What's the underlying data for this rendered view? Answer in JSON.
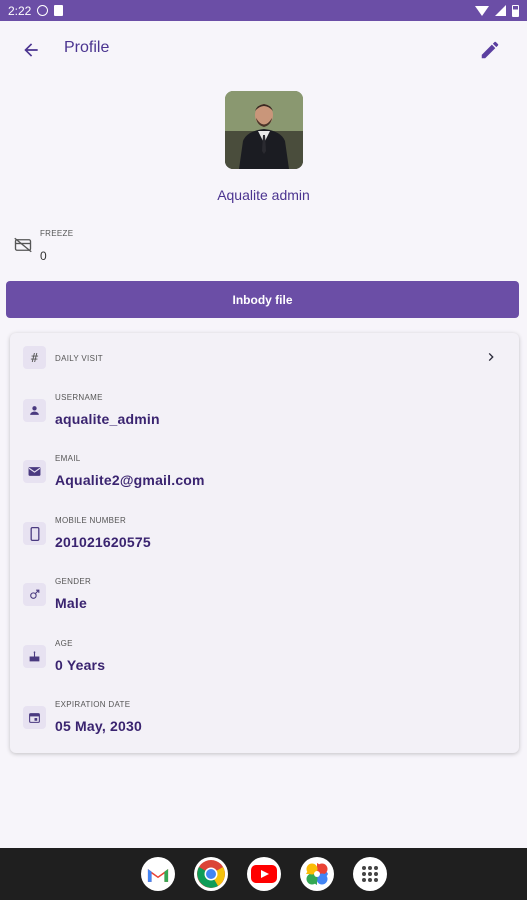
{
  "status_bar": {
    "time": "2:22"
  },
  "app_bar": {
    "title": "Profile"
  },
  "profile": {
    "name": "Aqualite admin"
  },
  "freeze": {
    "label": "FREEZE",
    "value": "0"
  },
  "inbody_button": {
    "label": "Inbody file"
  },
  "details": {
    "daily_visit": {
      "label": "DAILY VISIT"
    },
    "username": {
      "label": "USERNAME",
      "value": "aqualite_admin"
    },
    "email": {
      "label": "EMAIL",
      "value": "Aqualite2@gmail.com"
    },
    "mobile": {
      "label": "MOBILE NUMBER",
      "value": "201021620575"
    },
    "gender": {
      "label": "GENDER",
      "value": "Male"
    },
    "age": {
      "label": "AGE",
      "value": "0 Years"
    },
    "expiration": {
      "label": "EXPIRATION DATE",
      "value": "05 May, 2030"
    }
  },
  "dock": {
    "apps": [
      "gmail-icon",
      "chrome-icon",
      "youtube-icon",
      "photos-icon",
      "app-drawer-icon"
    ]
  },
  "colors": {
    "primary": "#6b4ea6",
    "text_dark": "#3a2470",
    "background": "#f7f5fa"
  }
}
